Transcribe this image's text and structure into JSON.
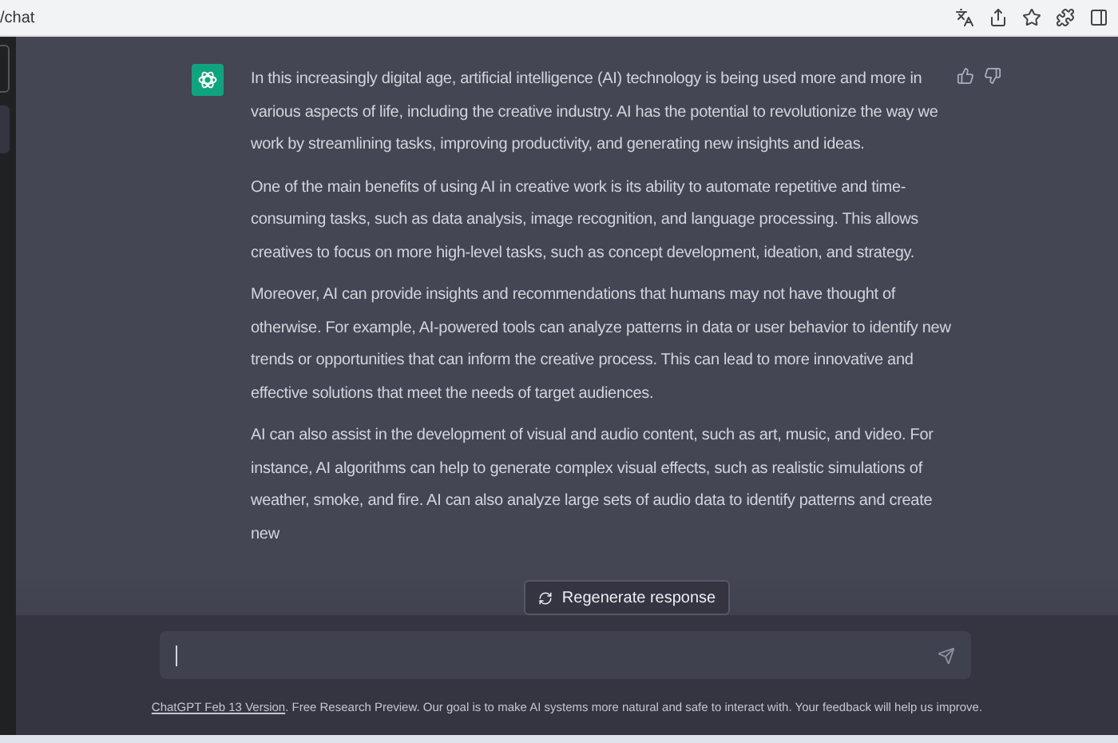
{
  "browser": {
    "url": "/chat"
  },
  "message": {
    "paragraphs": [
      "In this increasingly digital age, artificial intelligence (AI) technology is being used more and more in various aspects of life, including the creative industry. AI has the potential to revolutionize the way we work by streamlining tasks, improving productivity, and generating new insights and ideas.",
      "One of the main benefits of using AI in creative work is its ability to automate repetitive and time-consuming tasks, such as data analysis, image recognition, and language processing. This allows creatives to focus on more high-level tasks, such as concept development, ideation, and strategy.",
      "Moreover, AI can provide insights and recommendations that humans may not have thought of otherwise. For example, AI-powered tools can analyze patterns in data or user behavior to identify new trends or opportunities that can inform the creative process. This can lead to more innovative and effective solutions that meet the needs of target audiences.",
      "AI can also assist in the development of visual and audio content, such as art, music, and video. For instance, AI algorithms can help to generate complex visual effects, such as realistic simulations of weather, smoke, and fire. AI can also analyze large sets of audio data to identify patterns and create new"
    ]
  },
  "regenerate_button": "Regenerate response",
  "footer": {
    "link": "ChatGPT Feb 13 Version",
    "text": ". Free Research Preview. Our goal is to make AI systems more natural and safe to interact with. Your feedback will help us improve."
  }
}
